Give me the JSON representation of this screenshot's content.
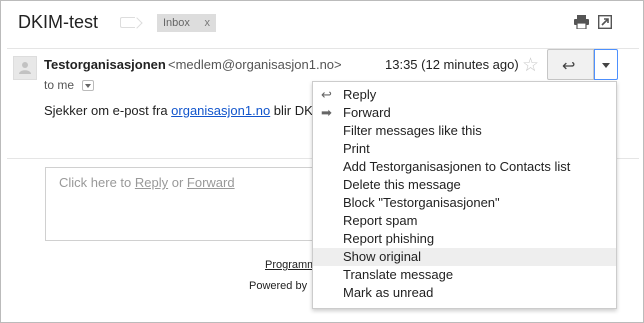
{
  "subject": "DKIM-test",
  "labels": {
    "inbox": "Inbox",
    "remove": "x"
  },
  "message": {
    "sender_name": "Testorganisasjonen",
    "sender_email": "<medlem@organisasjon1.no>",
    "timestamp": "13:35 (12 minutes ago)",
    "to_line": "to me",
    "body_prefix": "Sjekker om e-post fra ",
    "body_link": "organisasjon1.no",
    "body_suffix": " blir DK"
  },
  "reply_box": {
    "prefix": "Click here to ",
    "reply": "Reply",
    "or": " or ",
    "forward": "Forward"
  },
  "footer": {
    "program": "Programm",
    "powered": "Powered by"
  },
  "menu": {
    "items": [
      {
        "label": "Reply",
        "icon": "reply-arrow"
      },
      {
        "label": "Forward",
        "icon": "forward-arrow"
      },
      {
        "label": "Filter messages like this"
      },
      {
        "label": "Print"
      },
      {
        "label": "Add Testorganisasjonen to Contacts list"
      },
      {
        "label": "Delete this message"
      },
      {
        "label": "Block \"Testorganisasjonen\""
      },
      {
        "label": "Report spam"
      },
      {
        "label": "Report phishing"
      },
      {
        "label": "Show original",
        "highlighted": true
      },
      {
        "label": "Translate message"
      },
      {
        "label": "Mark as unread"
      }
    ]
  },
  "icons": {
    "reply": "↩",
    "forward": "➡",
    "star": "☆"
  }
}
